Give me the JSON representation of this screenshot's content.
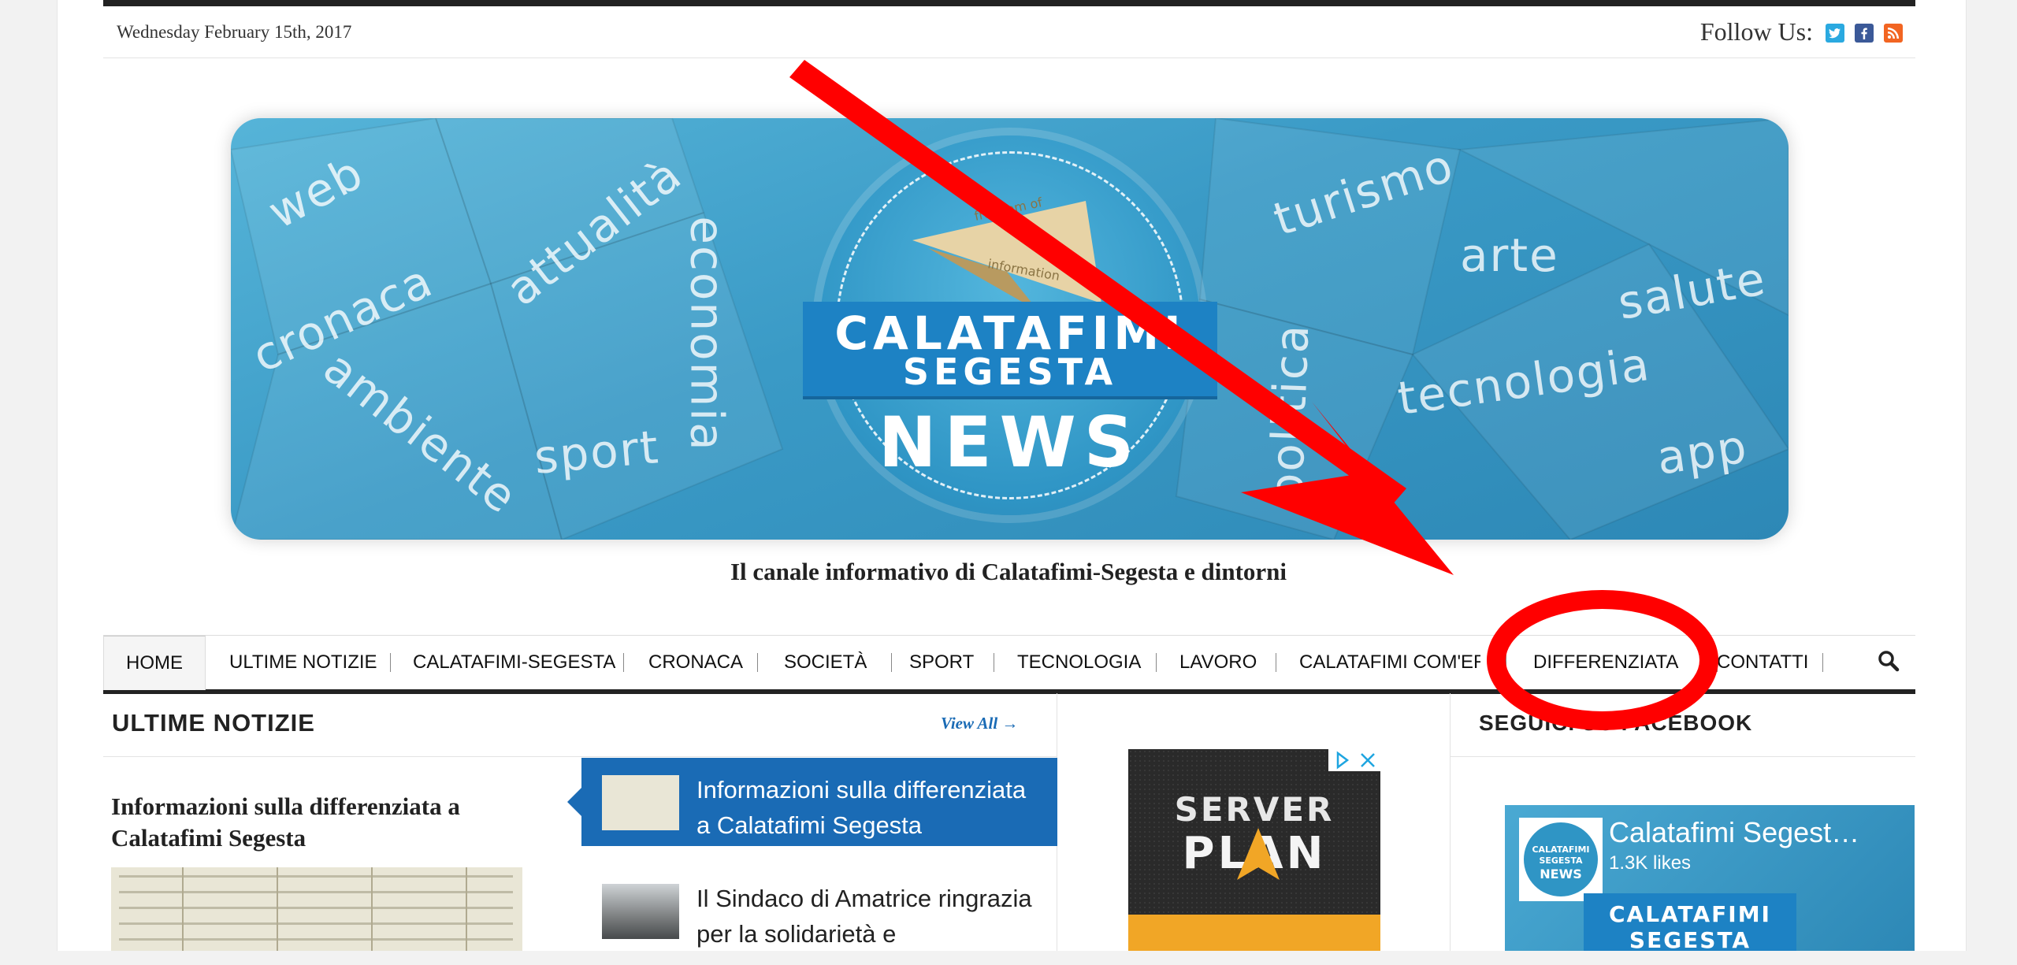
{
  "header": {
    "date": "Wednesday February 15th, 2017",
    "follow_label": "Follow Us:",
    "social_icons": [
      "twitter-icon",
      "facebook-icon",
      "rss-icon"
    ]
  },
  "banner": {
    "logo_line1": "CALATAFIMI",
    "logo_line2": "SEGESTA",
    "logo_line3": "NEWS",
    "plane_text1": "freedom of",
    "plane_text2": "information",
    "words": [
      "web",
      "attualità",
      "cronaca",
      "ambiente",
      "sport",
      "economia",
      "turismo",
      "arte",
      "salute",
      "tecnologia",
      "app",
      "politica"
    ]
  },
  "tagline": "Il canale informativo di Calatafimi-Segesta e dintorni",
  "nav": {
    "items": [
      "HOME",
      "ULTIME NOTIZIE",
      "CALATAFIMI-SEGESTA",
      "CRONACA",
      "SOCIETÀ",
      "SPORT",
      "TECNOLOGIA",
      "LAVORO",
      "CALATAFIMI COM'ERA",
      "DIFFERENZIATA",
      "CONTATTI"
    ],
    "active": "HOME"
  },
  "latest": {
    "title": "ULTIME NOTIZIE",
    "view_all": "View All →",
    "lead_title": "Informazioni sulla differenziata a Calatafimi Segesta",
    "items": [
      {
        "text": "Informazioni sulla differenziata a Calatafimi Segesta",
        "active": true
      },
      {
        "text": "Il Sindaco di Amatrice ringrazia per la solidarietà e",
        "active": false
      }
    ]
  },
  "ad": {
    "line1": "SERVER",
    "line2": "PLAN"
  },
  "facebook": {
    "section_title": "SEGUICI SU FACEBOOK",
    "page_name": "Calatafimi Segest…",
    "likes": "1.3K likes",
    "logo_line1": "CALATAFIMI",
    "logo_line2": "SEGESTA",
    "logo_line3": "NEWS",
    "cover_text": "CALATAFIMI SEGESTA"
  },
  "annotations": {
    "color": "#ff0000"
  }
}
